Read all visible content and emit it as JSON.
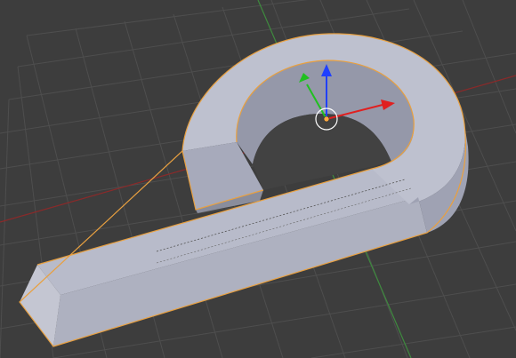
{
  "viewport": {
    "background_color": "#3d3d3d",
    "grid_color": "#4d4d4d",
    "x_axis_color": "#9b2b2b",
    "y_axis_color": "#3f8f3f",
    "object_fill_color": "#b9bccb",
    "object_shade_color": "#8c8f9e",
    "selection_outline_color": "#f0a040",
    "gizmo": {
      "x_arrow_color": "#e02020",
      "y_arrow_color": "#20c020",
      "z_arrow_color": "#2040ff",
      "origin_color": "#ffaa40",
      "icons": [
        "move-gizmo-icon",
        "origin-point-icon",
        "pivot-circle-icon"
      ]
    },
    "object": {
      "type": "mesh",
      "selected": true,
      "shape": "curled-handle"
    }
  }
}
